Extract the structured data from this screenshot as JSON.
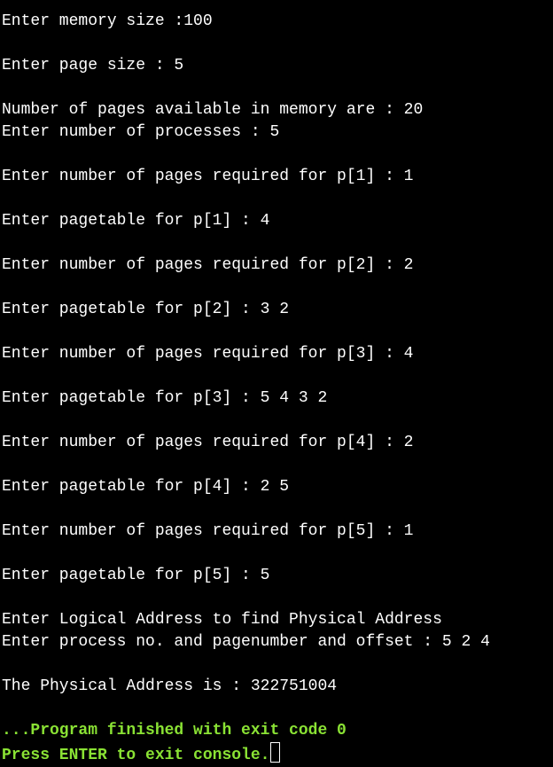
{
  "console": {
    "lines": [
      "Enter memory size :100",
      "",
      "Enter page size : 5",
      "",
      "Number of pages available in memory are : 20",
      "Enter number of processes : 5",
      "",
      "Enter number of pages required for p[1] : 1",
      "",
      "Enter pagetable for p[1] : 4",
      "",
      "Enter number of pages required for p[2] : 2",
      "",
      "Enter pagetable for p[2] : 3 2",
      "",
      "Enter number of pages required for p[3] : 4",
      "",
      "Enter pagetable for p[3] : 5 4 3 2",
      "",
      "Enter number of pages required for p[4] : 2",
      "",
      "Enter pagetable for p[4] : 2 5",
      "",
      "Enter number of pages required for p[5] : 1",
      "",
      "Enter pagetable for p[5] : 5",
      "",
      "Enter Logical Address to find Physical Address",
      "Enter process no. and pagenumber and offset : 5 2 4",
      "",
      "The Physical Address is : 322751004",
      ""
    ],
    "finished_message": "...Program finished with exit code 0",
    "exit_prompt": "Press ENTER to exit console."
  },
  "colors": {
    "background": "#000000",
    "text": "#ffffff",
    "finish_text": "#8ae234"
  }
}
